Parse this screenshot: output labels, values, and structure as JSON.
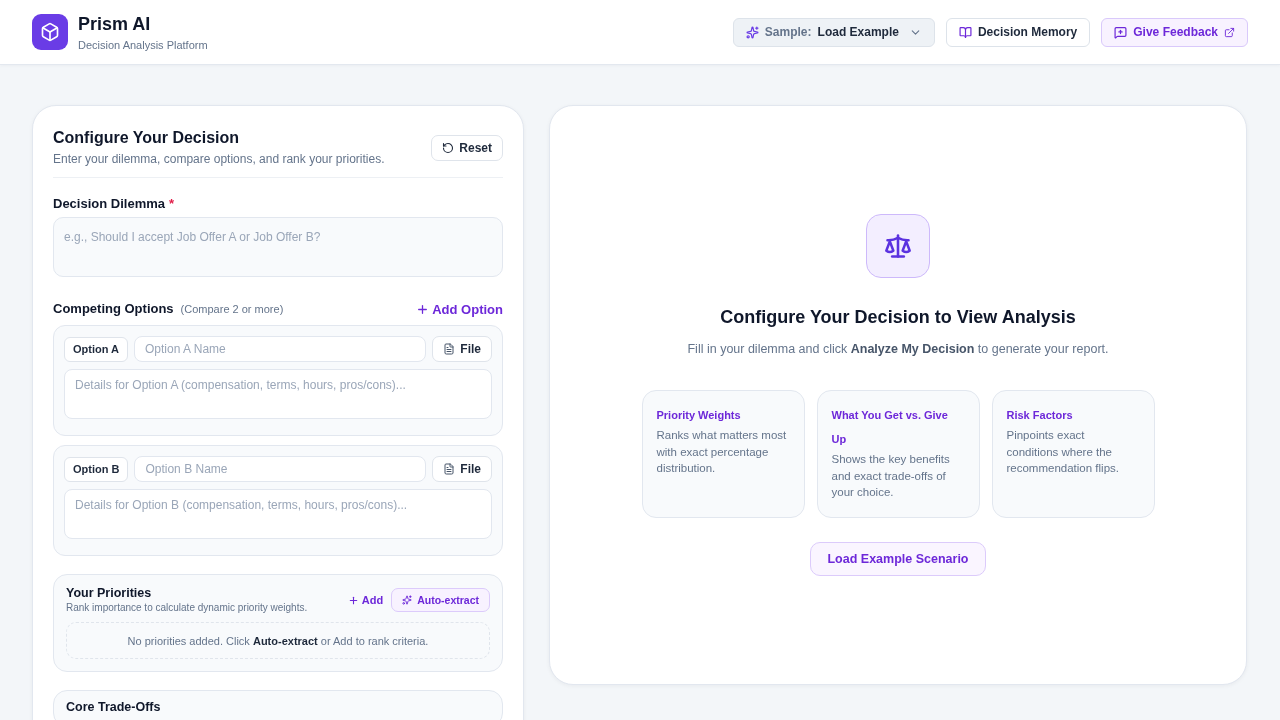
{
  "header": {
    "title": "Prism AI",
    "subtitle": "Decision Analysis Platform",
    "sample": {
      "label": "Sample:",
      "value": "Load Example"
    },
    "buttons": [
      {
        "kind": "memory",
        "label": "Decision Memory"
      },
      {
        "kind": "feedback",
        "label": "Give Feedback"
      }
    ]
  },
  "config": {
    "title": "Configure Your Decision",
    "subtitle": "Enter your dilemma, compare options, and rank your priorities.",
    "reset": "Reset",
    "dilemma": {
      "label": "Decision Dilemma",
      "required_mark": "*",
      "placeholder": "e.g., Should I accept Job Offer A or Job Offer B?"
    },
    "options_section": {
      "title": "Competing Options",
      "hint": "(Compare 2 or more)",
      "add": "Add Option"
    },
    "options": [
      {
        "tag": "Option A",
        "name_placeholder": "Option A Name",
        "file": "File",
        "details_placeholder": "Details for Option A (compensation, terms, hours, pros/cons)..."
      },
      {
        "tag": "Option B",
        "name_placeholder": "Option B Name",
        "file": "File",
        "details_placeholder": "Details for Option B (compensation, terms, hours, pros/cons)..."
      }
    ],
    "priorities": {
      "title": "Your Priorities",
      "subtitle": "Rank importance to calculate dynamic priority weights.",
      "add": "Add",
      "auto_extract": "Auto-extract",
      "empty": "No priorities added. Click **Auto-extract** or Add to rank criteria."
    },
    "tradeoffs": {
      "title": "Core Trade-Offs"
    }
  },
  "analysis": {
    "title": "Configure Your Decision to View Analysis",
    "subtitle": "Fill in your dilemma and click **Analyze My Decision** to generate your report.",
    "features": [
      {
        "title": "Priority Weights",
        "description": "Ranks what matters most with exact percentage distribution."
      },
      {
        "title": "What You Get vs. Give Up",
        "description": "Shows the key benefits and exact trade-offs of your choice."
      },
      {
        "title": "Risk Factors",
        "description": "Pinpoints exact conditions where the recommendation flips."
      }
    ],
    "load_button": "Load Example Scenario"
  }
}
